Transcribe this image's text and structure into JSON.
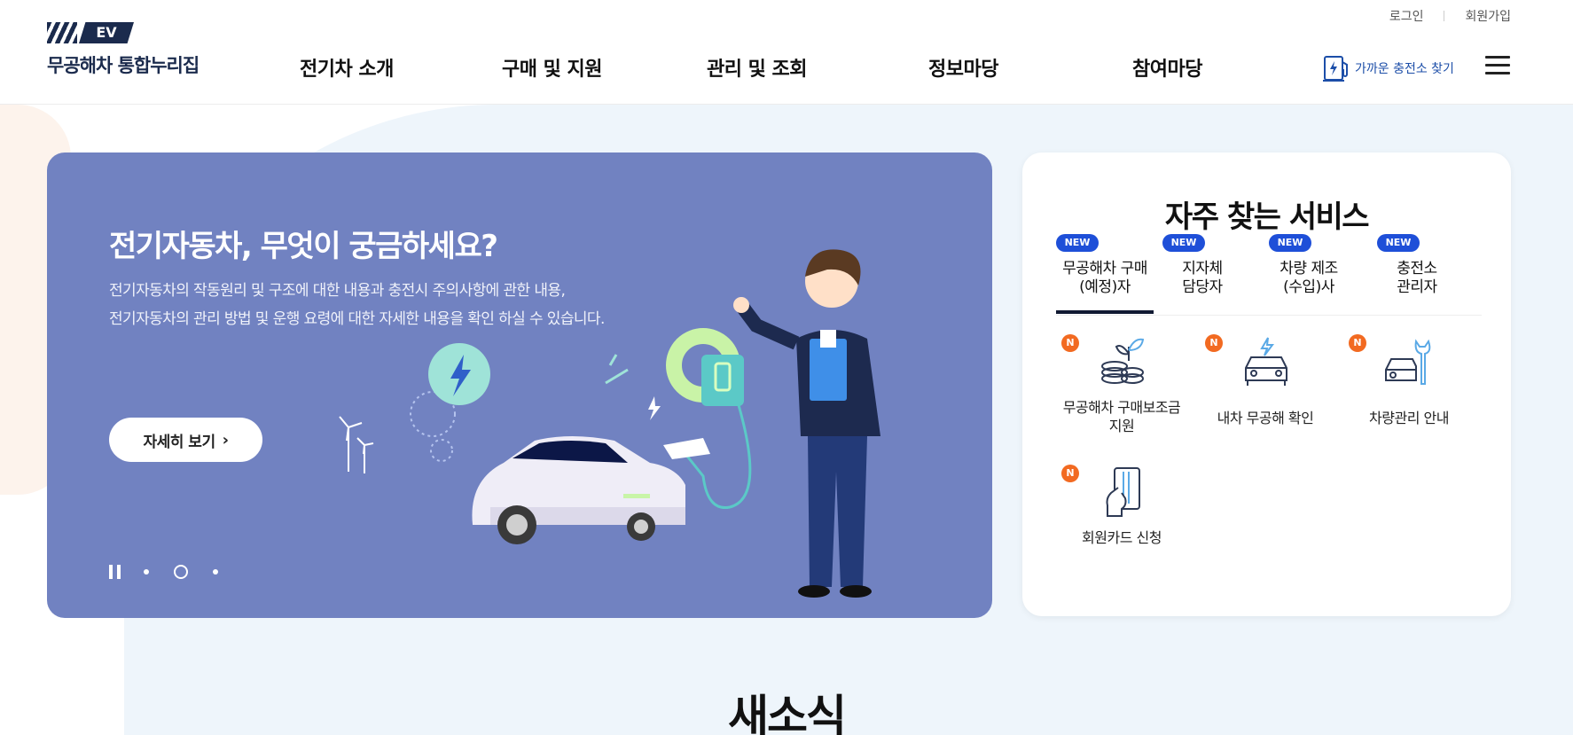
{
  "header": {
    "logo_badge": "EV",
    "logo_text": "무공해차 통합누리집",
    "util": {
      "login": "로그인",
      "signup": "회원가입"
    },
    "nav": [
      "전기차 소개",
      "구매 및 지원",
      "관리 및 조회",
      "정보마당",
      "참여마당"
    ],
    "charge_finder": "가까운 충전소 찾기"
  },
  "hero": {
    "title": "전기자동차, 무엇이 궁금하세요?",
    "desc_line1": "전기자동차의 작동원리 및 구조에 대한 내용과 충전시 주의사항에 관한 내용,",
    "desc_line2": "전기자동차의 관리 방법 및 운행 요령에 대한 자세한 내용을 확인 하실 수 있습니다.",
    "button": "자세히 보기",
    "slide_count": 3,
    "active_slide": 2
  },
  "services": {
    "title": "자주 찾는 서비스",
    "new_badge": "NEW",
    "tabs": [
      {
        "line1": "무공해차 구매",
        "line2": "(예정)자",
        "active": true
      },
      {
        "line1": "지자체",
        "line2": "담당자",
        "active": false
      },
      {
        "line1": "차량 제조",
        "line2": "(수입)사",
        "active": false
      },
      {
        "line1": "충전소",
        "line2": "관리자",
        "active": false
      }
    ],
    "item_badge": "N",
    "items": [
      {
        "line1": "무공해차 구매보조금",
        "line2": "지원",
        "icon": "coins-plant-icon"
      },
      {
        "line1": "내차 무공해 확인",
        "line2": "",
        "icon": "ev-car-icon"
      },
      {
        "line1": "차량관리 안내",
        "line2": "",
        "icon": "car-wrench-icon"
      },
      {
        "line1": "회원카드 신청",
        "line2": "",
        "icon": "member-card-icon"
      }
    ]
  },
  "news": {
    "title": "새소식"
  },
  "colors": {
    "brand": "#1b2b4d",
    "hero_bg": "#7182c1",
    "new_badge": "#1e4fd8",
    "n_badge": "#f26a21",
    "link": "#1c4ea8"
  }
}
